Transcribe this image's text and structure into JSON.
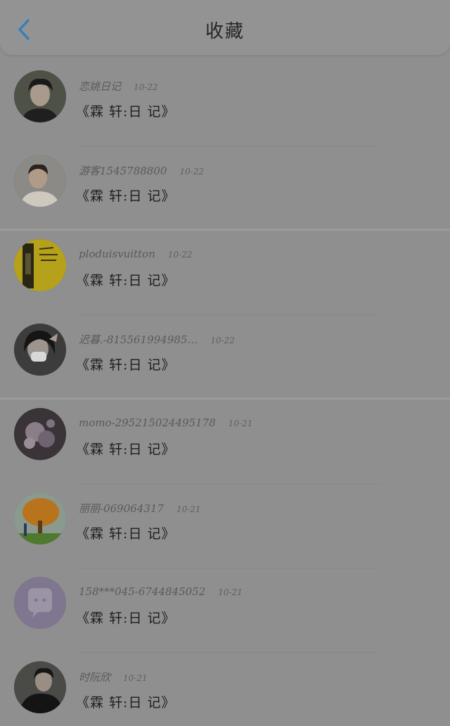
{
  "header": {
    "title": "收藏",
    "back_icon": "chevron-left-icon",
    "accent": "#2f7fbf"
  },
  "favorites": [
    {
      "user": "恋姚日记",
      "date": "10-22",
      "title": "《霖 轩:日 记》",
      "avatar": "portrait-boy-dark"
    },
    {
      "user": "游客1545788800",
      "date": "10-22",
      "title": "《霖 轩:日 记》",
      "avatar": "portrait-boy-light"
    },
    {
      "user": "ploduisvuitton",
      "date": "10-22",
      "title": "《霖 轩:日 记》",
      "avatar": "yellow-poster"
    },
    {
      "user": "迟暮.-815561994985…",
      "date": "10-22",
      "title": "《霖 轩:日 记》",
      "avatar": "girl-with-mask"
    },
    {
      "user": "momo-295215024495178",
      "date": "10-21",
      "title": "《霖 轩:日 记》",
      "avatar": "dark-blossom"
    },
    {
      "user": "丽丽-069064317",
      "date": "10-21",
      "title": "《霖 轩:日 记》",
      "avatar": "orange-tree"
    },
    {
      "user": "158***045-6744845052",
      "date": "10-21",
      "title": "《霖 轩:日 记》",
      "avatar": "default-chat-icon"
    },
    {
      "user": "时阮欣",
      "date": "10-21",
      "title": "《霖 轩:日 记》",
      "avatar": "portrait-boy-black"
    }
  ]
}
